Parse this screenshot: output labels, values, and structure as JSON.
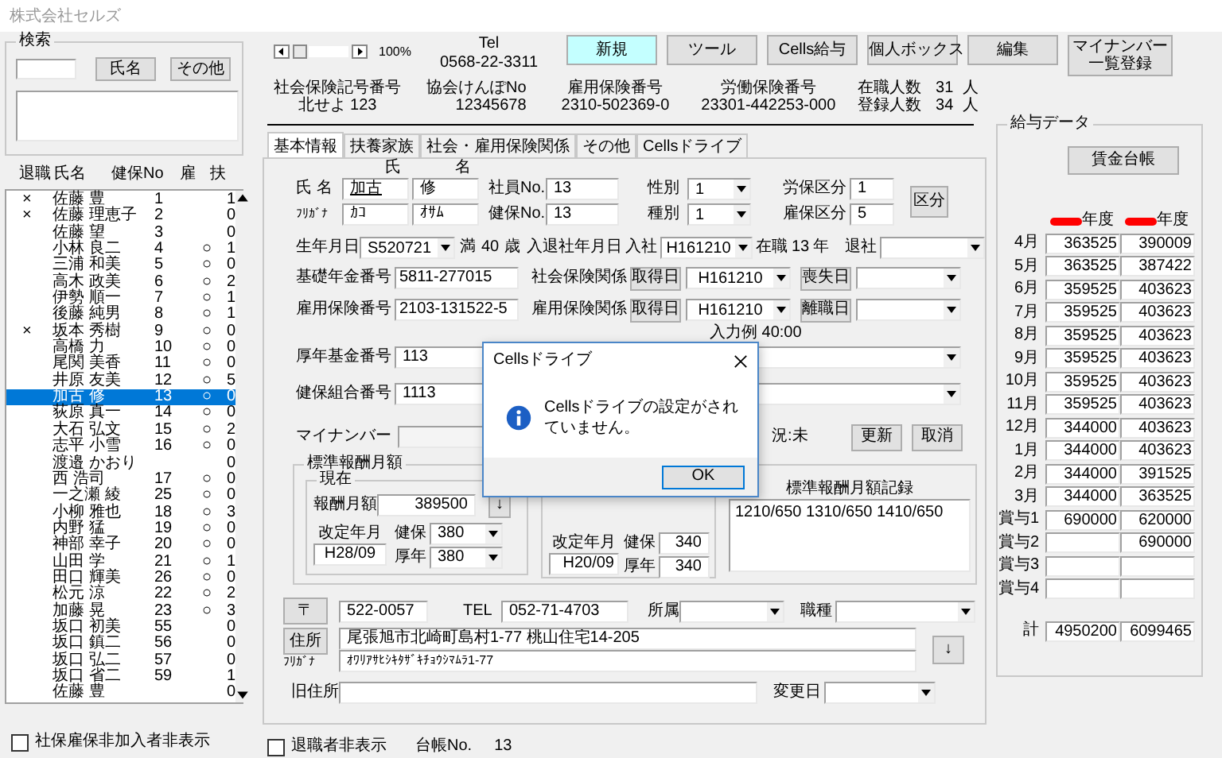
{
  "window": {
    "title": "株式会社セルズ"
  },
  "search": {
    "legend": "検索",
    "buttons": [
      "氏名",
      "その他"
    ]
  },
  "employee_list": {
    "columns": [
      "退職",
      "氏名",
      "健保No",
      "雇",
      "扶"
    ],
    "rows": [
      {
        "retired": "×",
        "name": "佐藤 豊",
        "no": "1",
        "dependents": "1",
        "selected": false
      },
      {
        "retired": "×",
        "name": "佐藤 理恵子",
        "no": "2",
        "dependents": "0",
        "selected": false
      },
      {
        "name": "佐藤 望",
        "no": "3",
        "dependents": "0",
        "selected": false
      },
      {
        "name": "小林 良二",
        "no": "4",
        "insured": "○",
        "dependents": "1",
        "selected": false
      },
      {
        "name": "三浦 和美",
        "no": "5",
        "insured": "○",
        "dependents": "0",
        "selected": false
      },
      {
        "name": "高木 政美",
        "no": "6",
        "insured": "○",
        "dependents": "2",
        "selected": false
      },
      {
        "name": "伊勢 順一",
        "no": "7",
        "insured": "○",
        "dependents": "1",
        "selected": false
      },
      {
        "name": "後藤 純男",
        "no": "8",
        "insured": "○",
        "dependents": "1",
        "selected": false
      },
      {
        "retired": "×",
        "name": "坂本 秀樹",
        "no": "9",
        "insured": "○",
        "dependents": "0",
        "selected": false
      },
      {
        "name": "高橋 力",
        "no": "10",
        "insured": "○",
        "dependents": "0",
        "selected": false
      },
      {
        "name": "尾関 美香",
        "no": "11",
        "insured": "○",
        "dependents": "0",
        "selected": false
      },
      {
        "name": "井原 友美",
        "no": "12",
        "insured": "○",
        "dependents": "5",
        "selected": false
      },
      {
        "name": "加古 修",
        "no": "13",
        "insured": "○",
        "dependents": "0",
        "selected": true
      },
      {
        "name": "荻原 真一",
        "no": "14",
        "insured": "○",
        "dependents": "0",
        "selected": false
      },
      {
        "name": "大石 弘文",
        "no": "15",
        "insured": "○",
        "dependents": "2",
        "selected": false
      },
      {
        "name": "志平 小雪",
        "no": "16",
        "insured": "○",
        "dependents": "0",
        "selected": false
      },
      {
        "name": "渡邉 かおり",
        "dependents": "0",
        "selected": false
      },
      {
        "name": "西 浩司",
        "no": "17",
        "insured": "○",
        "dependents": "0",
        "selected": false
      },
      {
        "name": "一之瀬 綾",
        "no": "25",
        "insured": "○",
        "dependents": "0",
        "selected": false
      },
      {
        "name": "小柳 雅也",
        "no": "18",
        "insured": "○",
        "dependents": "3",
        "selected": false
      },
      {
        "name": "内野 猛",
        "no": "19",
        "insured": "○",
        "dependents": "0",
        "selected": false
      },
      {
        "name": "神部 幸子",
        "no": "20",
        "insured": "○",
        "dependents": "0",
        "selected": false
      },
      {
        "name": "山田 学",
        "no": "21",
        "insured": "○",
        "dependents": "1",
        "selected": false
      },
      {
        "name": "田口 輝美",
        "no": "26",
        "insured": "○",
        "dependents": "0",
        "selected": false
      },
      {
        "name": "松元 涼",
        "no": "22",
        "insured": "○",
        "dependents": "2",
        "selected": false
      },
      {
        "name": "加藤 晃",
        "no": "23",
        "insured": "○",
        "dependents": "3",
        "selected": false
      },
      {
        "name": "坂口 初美",
        "no": "55",
        "dependents": "0",
        "selected": false
      },
      {
        "name": "坂口 鎮二",
        "no": "56",
        "dependents": "0",
        "selected": false
      },
      {
        "name": "坂口 弘二",
        "no": "57",
        "dependents": "0",
        "selected": false
      },
      {
        "name": "坂口 省二",
        "no": "59",
        "dependents": "1",
        "selected": false
      },
      {
        "name": "佐藤 豊",
        "dependents": "0",
        "selected": false
      }
    ]
  },
  "hide_uninsured": {
    "label": "社保雇保非加入者非表示",
    "checked": false
  },
  "toolbar": {
    "zoom": "100%",
    "tel_label": "Tel",
    "tel": "0568-22-3311",
    "buttons": [
      {
        "label": "新規",
        "selected": true
      },
      {
        "label": "ツール",
        "selected": false
      },
      {
        "label": "Cells給与",
        "selected": false
      },
      {
        "label": "個人ボックス",
        "selected": false
      },
      {
        "label": "編集",
        "selected": false
      },
      {
        "label": "マイナンバー一覧登録",
        "selected": false
      }
    ]
  },
  "company_info": [
    {
      "label": "社会保険記号番号",
      "value": "北せよ 123"
    },
    {
      "label": "協会けんぽNo",
      "value": "12345678"
    },
    {
      "label": "雇用保険番号",
      "value": "2310-502369-0"
    },
    {
      "label": "労働保険番号",
      "value": "23301-442253-000"
    }
  ],
  "headcount": [
    {
      "label": "在職人数",
      "value": "31",
      "unit": "人"
    },
    {
      "label": "登録人数",
      "value": "34",
      "unit": "人"
    }
  ],
  "tabs": [
    {
      "label": "基本情報",
      "selected": true
    },
    {
      "label": "扶養家族",
      "selected": false
    },
    {
      "label": "社会・雇用保険関係",
      "selected": false
    },
    {
      "label": "その他",
      "selected": false
    },
    {
      "label": "Cellsドライブ",
      "selected": false
    }
  ],
  "form": {
    "name": {
      "col_labels": [
        "氏",
        "名"
      ],
      "label": "氏 名",
      "family": "加古",
      "given": "修",
      "kana_label": "ﾌﾘｶﾞﾅ",
      "kana_family": "ｶｺ",
      "kana_given": "ｵｻﾑ"
    },
    "employee_no": {
      "label": "社員No.",
      "value": "13"
    },
    "health_no": {
      "label": "健保No.",
      "value": "13"
    },
    "gender": {
      "label": "性別",
      "value": "1"
    },
    "category": {
      "label": "種別",
      "value": "1"
    },
    "labor_class": {
      "label": "労保区分",
      "value": "1"
    },
    "employment_class": {
      "label": "雇保区分",
      "value": "5"
    },
    "class_button": "区分",
    "birth": {
      "label": "生年月日",
      "value": "S520721",
      "age_prefix": "満",
      "age": "40",
      "age_unit": "歳"
    },
    "joining": {
      "label": "入退社年月日",
      "join_label": "入社",
      "join": "H161210",
      "tenure_label": "在職",
      "tenure": "13",
      "tenure_unit": "年",
      "leave_label": "退社"
    },
    "pension_no": {
      "label": "基礎年金番号",
      "value": "5811-277015"
    },
    "employment_insurance_no": {
      "label": "雇用保険番号",
      "value": "2103-131522-5"
    },
    "social_insurance": {
      "label": "社会保険関係",
      "acquired_button": "取得日",
      "acquired": "H161210",
      "lost_button": "喪失日"
    },
    "employment_insurance": {
      "label": "雇用保険関係",
      "acquired_button": "取得日",
      "acquired": "H161210",
      "lost_button": "離職日"
    },
    "input_example": "入力例 40:00",
    "fund_no": {
      "label": "厚年基金番号",
      "value": "113"
    },
    "union_no": {
      "label": "健保組合番号",
      "value": "1113"
    },
    "my_number": {
      "label": "マイナンバー",
      "status": "況:未",
      "buttons": [
        "更新",
        "取消"
      ]
    },
    "standard_pay": {
      "legend": "標準報酬月額",
      "current": {
        "legend": "現在",
        "pay_label": "報酬月額",
        "pay": "389500",
        "arrow": "↓",
        "revised_label": "改定年月",
        "revised": "H28/09",
        "health_label": "健保",
        "health": "380",
        "pension_label": "厚年",
        "pension": "380"
      },
      "previous": {
        "revised_label": "改定年月",
        "revised": "H20/09",
        "health_label": "健保",
        "health": "340",
        "pension_label": "厚年",
        "pension": "340"
      },
      "record_label": "標準報酬月額記録",
      "record": "1210/650 1310/650 1410/650"
    },
    "address": {
      "zip_button": "〒",
      "zip": "522-0057",
      "tel_label": "TEL",
      "tel": "052-71-4703",
      "dept_label": "所属",
      "job_label": "職種",
      "address_button": "住所",
      "address": "尾張旭市北崎町島村1-77  桃山住宅14-205",
      "kana_label": "ﾌﾘｶﾞﾅ",
      "kana": "ｵﾜﾘｱｻﾋｼｷﾀｻﾞｷﾁｮｳｼﾏﾑﾗ1-77",
      "arrow": "↓",
      "old_label": "旧住所",
      "changed_label": "変更日"
    }
  },
  "footer": {
    "hide_retired": {
      "label": "退職者非表示",
      "checked": false
    },
    "ledger_label": "台帳No.",
    "ledger_no": "13"
  },
  "salary": {
    "legend": "給与データ",
    "button": "賃金台帳",
    "year_headers": [
      "年度",
      "年度"
    ],
    "rows": [
      {
        "label": "4月",
        "cells": [
          {
            "value": "363525"
          },
          {
            "value": "390009"
          }
        ]
      },
      {
        "label": "5月",
        "cells": [
          {
            "value": "363525"
          },
          {
            "value": "387422"
          }
        ]
      },
      {
        "label": "6月",
        "cells": [
          {
            "value": "359525"
          },
          {
            "value": "403623"
          }
        ]
      },
      {
        "label": "7月",
        "cells": [
          {
            "value": "359525"
          },
          {
            "value": "403623"
          }
        ]
      },
      {
        "label": "8月",
        "cells": [
          {
            "value": "359525"
          },
          {
            "value": "403623"
          }
        ]
      },
      {
        "label": "9月",
        "cells": [
          {
            "value": "359525"
          },
          {
            "value": "403623"
          }
        ]
      },
      {
        "label": "10月",
        "cells": [
          {
            "value": "359525"
          },
          {
            "value": "403623"
          }
        ]
      },
      {
        "label": "11月",
        "cells": [
          {
            "value": "359525"
          },
          {
            "value": "403623"
          }
        ]
      },
      {
        "label": "12月",
        "cells": [
          {
            "value": "344000"
          },
          {
            "value": "403623"
          }
        ]
      },
      {
        "label": "1月",
        "cells": [
          {
            "value": "344000"
          },
          {
            "value": "403623"
          }
        ]
      },
      {
        "label": "2月",
        "cells": [
          {
            "value": "344000"
          },
          {
            "value": "391525"
          }
        ]
      },
      {
        "label": "3月",
        "cells": [
          {
            "value": "344000"
          },
          {
            "value": "363525"
          }
        ]
      },
      {
        "label": "賞与1",
        "cells": [
          {
            "value": "690000"
          },
          {
            "value": "620000"
          }
        ]
      },
      {
        "label": "賞与2",
        "cells": [
          {},
          {
            "value": "690000"
          }
        ]
      },
      {
        "label": "賞与3",
        "cells": [
          {},
          {}
        ]
      },
      {
        "label": "賞与4",
        "cells": [
          {},
          {}
        ]
      }
    ],
    "total": {
      "label": "計",
      "values": [
        "4950200",
        "6099465"
      ]
    }
  },
  "dialog": {
    "title": "Cellsドライブ",
    "message": "Cellsドライブの設定がされていません。",
    "button": "OK"
  }
}
